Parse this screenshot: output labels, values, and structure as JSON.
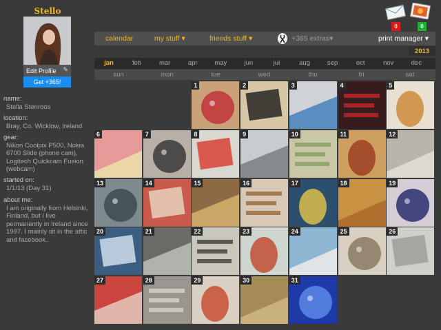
{
  "profile": {
    "name": "Stello",
    "edit_label": "Edit Profile",
    "get_label": "Get +365!"
  },
  "info": {
    "name_label": "name:",
    "name_value": "Stella Stenroos",
    "location_label": "location:",
    "location_value": "Bray, Co. Wicklow, Ireland",
    "gear_label": "gear:",
    "gear_value": "Nikon Coolpix P500, Nokia 6700 Slide (phone cam), Logitech Quickcam Fusion (webcam)",
    "started_label": "started on:",
    "started_value": "1/1/13 (Day 31)",
    "about_label": "about me:",
    "about_value": "I am originally from Helsinki, Finland, but I live permanently in Ireland since 1997. I mainly sit in the attic and facebook.."
  },
  "badges": {
    "messages": "0",
    "photos": "0"
  },
  "nav": {
    "calendar": "calendar",
    "my_stuff": "my stuff ▾",
    "friends_stuff": "friends stuff ▾",
    "extras": "+365 extras▾",
    "print_manager": "print manager ▾"
  },
  "year": "2013",
  "months": [
    "jan",
    "feb",
    "mar",
    "apr",
    "may",
    "jun",
    "jul",
    "aug",
    "sep",
    "oct",
    "nov",
    "dec"
  ],
  "active_month": "jan",
  "weekdays": [
    "sun",
    "mon",
    "tue",
    "wed",
    "thu",
    "fri",
    "sat"
  ],
  "days": [
    {
      "day": "1",
      "icon": "monster-toy-photo",
      "bg": "#c9a27a",
      "fg": "#c0343a"
    },
    {
      "day": "2",
      "icon": "dark-chocolates-photo",
      "bg": "#d8c7a4",
      "fg": "#1b1b1b"
    },
    {
      "day": "3",
      "icon": "imodium-box-photo",
      "bg": "#cfd3d8",
      "fg": "#2a6fb7"
    },
    {
      "day": "4",
      "icon": "pepsi-max-photo",
      "bg": "#1a1a1a",
      "fg": "#d8282c"
    },
    {
      "day": "5",
      "icon": "pizza-photo",
      "bg": "#e8e0d0",
      "fg": "#c9862f"
    },
    {
      "day": "6",
      "icon": "sticky-notes-photo",
      "bg": "#e9d7a8",
      "fg": "#e36a8c"
    },
    {
      "day": "7",
      "icon": "cables-photo",
      "bg": "#b8b0a6",
      "fg": "#3a3a3a"
    },
    {
      "day": "8",
      "icon": "vegetables-photo",
      "bg": "#d8d8d0",
      "fg": "#d93b2b"
    },
    {
      "day": "9",
      "icon": "notebook-photo",
      "bg": "#c8ccce",
      "fg": "#6a6e72"
    },
    {
      "day": "10",
      "icon": "magazines-photo",
      "bg": "#d7cfb6",
      "fg": "#7a9a55"
    },
    {
      "day": "11",
      "icon": "pizza-photo",
      "bg": "#cf9f60",
      "fg": "#9a3a1e"
    },
    {
      "day": "12",
      "icon": "paper-photo",
      "bg": "#ddd9cf",
      "fg": "#9a9690"
    },
    {
      "day": "13",
      "icon": "street-photo",
      "bg": "#7e8a8e",
      "fg": "#3c4a4f"
    },
    {
      "day": "14",
      "icon": "striped-cloth-photo",
      "bg": "#c95b4e",
      "fg": "#e9d9c4"
    },
    {
      "day": "15",
      "icon": "food-plate-photo",
      "bg": "#8d6a44",
      "fg": "#e3c276"
    },
    {
      "day": "16",
      "icon": "cake-photo",
      "bg": "#e5ddd0",
      "fg": "#8d5a2b"
    },
    {
      "day": "17",
      "icon": "phone-hand-photo",
      "bg": "#2c4f6d",
      "fg": "#e6c54a"
    },
    {
      "day": "18",
      "icon": "fries-photo",
      "bg": "#b06f2c",
      "fg": "#e0b05a"
    },
    {
      "day": "19",
      "icon": "selfie-photo",
      "bg": "#d5cdd6",
      "fg": "#2a2f6e"
    },
    {
      "day": "20",
      "icon": "laptop-screen-photo",
      "bg": "#3b5d80",
      "fg": "#d8e6f2"
    },
    {
      "day": "21",
      "icon": "phone-photo",
      "bg": "#6a6a66",
      "fg": "#d0d0cc"
    },
    {
      "day": "22",
      "icon": "handwriting-photo",
      "bg": "#e6e2d6",
      "fg": "#2a2a2a"
    },
    {
      "day": "23",
      "icon": "apple-photo",
      "bg": "#cfd6d0",
      "fg": "#c2452a"
    },
    {
      "day": "24",
      "icon": "document-photo",
      "bg": "#e1e4e6",
      "fg": "#4a90c2"
    },
    {
      "day": "25",
      "icon": "boxes-photo",
      "bg": "#d8d0c0",
      "fg": "#8a7a62"
    },
    {
      "day": "26",
      "icon": "roll-photo",
      "bg": "#cfcfcc",
      "fg": "#9a9a96"
    },
    {
      "day": "27",
      "icon": "book-photo",
      "bg": "#c9453e",
      "fg": "#ece6d8"
    },
    {
      "day": "28",
      "icon": "files-photo",
      "bg": "#8e8a84",
      "fg": "#e2ddd2"
    },
    {
      "day": "29",
      "icon": "pizza-photo",
      "bg": "#d9cfc2",
      "fg": "#c6472a"
    },
    {
      "day": "30",
      "icon": "sepia-portrait-photo",
      "bg": "#c8b27a",
      "fg": "#8a6d3a"
    },
    {
      "day": "31",
      "icon": "blue-bag-photo",
      "bg": "#1d3aa8",
      "fg": "#5c88e6"
    }
  ]
}
